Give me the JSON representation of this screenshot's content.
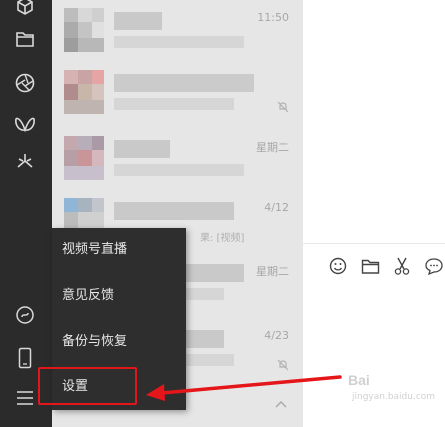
{
  "sidebar": {
    "icons": [
      "cube-icon",
      "folder-icon",
      "aperture-icon",
      "butterfly-icon",
      "sparkle-icon",
      "mini-program-icon",
      "phone-icon",
      "menu-icon"
    ]
  },
  "chat_list": {
    "rows": [
      {
        "time": "11:50",
        "snippet": ""
      },
      {
        "time": "",
        "snippet": ""
      },
      {
        "time": "星期二",
        "snippet": ""
      },
      {
        "time": "4/12",
        "snippet": "果: [视频]"
      },
      {
        "time": "星期二",
        "snippet": ""
      },
      {
        "time": "4/23",
        "snippet": ""
      }
    ]
  },
  "menu": {
    "items": [
      {
        "label": "视频号直播"
      },
      {
        "label": "意见反馈"
      },
      {
        "label": "备份与恢复"
      },
      {
        "label": "设置"
      }
    ]
  },
  "toolbar": {
    "icons": [
      "emoji-icon",
      "folder-icon",
      "scissors-icon",
      "chat-bubble-icon"
    ]
  },
  "watermark": {
    "text": "Bai",
    "sub": "jingyan.baidu.com"
  },
  "colors": {
    "sidebar": "#2b2b2b",
    "menu": "#2e2e2e",
    "highlight": "#e5161a",
    "chatlist": "#e6e6e6"
  }
}
